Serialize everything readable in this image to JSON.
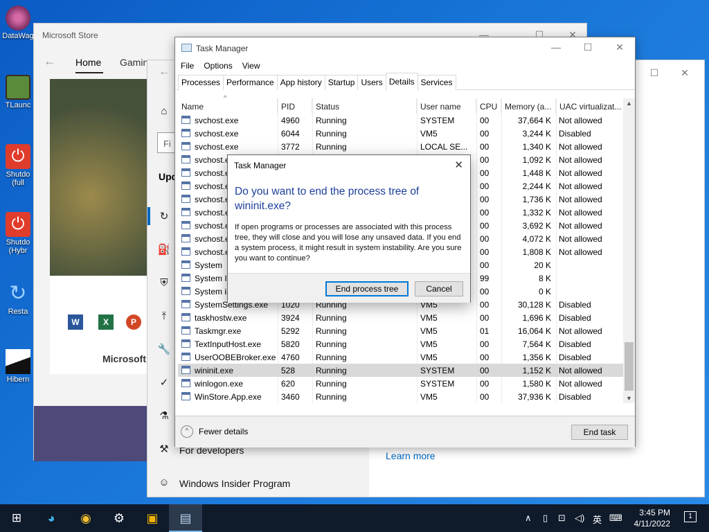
{
  "desktop": {
    "icons": [
      {
        "label": "DataWag",
        "color": "#b14a8a"
      },
      {
        "label": "TLaunc",
        "color": "#4f8a3a"
      },
      {
        "label": "Shutdo",
        "label2": "(full",
        "color": "#e03c2c"
      },
      {
        "label": "Shutdo",
        "label2": "(Hybr",
        "color": "#e03c2c"
      },
      {
        "label": "Resta",
        "color": "#2a8ae6"
      },
      {
        "label": "Hibern",
        "color": "#222222"
      }
    ]
  },
  "store": {
    "title": "Microsoft Store",
    "nav": {
      "home": "Home",
      "gaming": "Gamin"
    },
    "brand": "Microsoft"
  },
  "settings": {
    "header_partial": "Upd",
    "search_partial": "Fi",
    "items": [
      {
        "icon": "⌂"
      },
      {
        "icon": "↻"
      },
      {
        "icon": "⛽"
      },
      {
        "icon": "⛨"
      },
      {
        "icon": "⤒"
      },
      {
        "icon": "🔧"
      },
      {
        "icon": "✓"
      },
      {
        "icon": "⚗"
      }
    ],
    "for_developers": "For developers",
    "insider": "Windows Insider Program",
    "learn_more": "Learn more"
  },
  "task_manager": {
    "title": "Task Manager",
    "menu": [
      "File",
      "Options",
      "View"
    ],
    "tabs": [
      "Processes",
      "Performance",
      "App history",
      "Startup",
      "Users",
      "Details",
      "Services"
    ],
    "active_tab": "Details",
    "columns": [
      "Name",
      "PID",
      "Status",
      "User name",
      "CPU",
      "Memory (a...",
      "UAC virtualizat..."
    ],
    "rows": [
      {
        "name": "svchost.exe",
        "pid": "4960",
        "status": "Running",
        "user": "SYSTEM",
        "cpu": "00",
        "mem": "37,664 K",
        "uac": "Not allowed"
      },
      {
        "name": "svchost.exe",
        "pid": "6044",
        "status": "Running",
        "user": "VM5",
        "cpu": "00",
        "mem": "3,244 K",
        "uac": "Disabled"
      },
      {
        "name": "svchost.exe",
        "pid": "3772",
        "status": "Running",
        "user": "LOCAL SE...",
        "cpu": "00",
        "mem": "1,340 K",
        "uac": "Not allowed"
      },
      {
        "name": "svchost.exe",
        "pid": "",
        "status": "",
        "user": "",
        "cpu": "00",
        "mem": "1,092 K",
        "uac": "Not allowed"
      },
      {
        "name": "svchost.ex",
        "pid": "",
        "status": "",
        "user": "",
        "cpu": "00",
        "mem": "1,448 K",
        "uac": "Not allowed"
      },
      {
        "name": "svchost.ex",
        "pid": "",
        "status": "",
        "user": "",
        "cpu": "00",
        "mem": "2,244 K",
        "uac": "Not allowed"
      },
      {
        "name": "svchost.ex",
        "pid": "",
        "status": "",
        "user": "",
        "cpu": "00",
        "mem": "1,736 K",
        "uac": "Not allowed"
      },
      {
        "name": "svchost.ex",
        "pid": "",
        "status": "",
        "user": "",
        "cpu": "00",
        "mem": "1,332 K",
        "uac": "Not allowed"
      },
      {
        "name": "svchost.ex",
        "pid": "",
        "status": "",
        "user": "",
        "cpu": "00",
        "mem": "3,692 K",
        "uac": "Not allowed"
      },
      {
        "name": "svchost.ex",
        "pid": "",
        "status": "",
        "user": "",
        "cpu": "00",
        "mem": "4,072 K",
        "uac": "Not allowed"
      },
      {
        "name": "svchost.ex",
        "pid": "",
        "status": "",
        "user": "",
        "cpu": "00",
        "mem": "1,808 K",
        "uac": "Not allowed"
      },
      {
        "name": "System",
        "pid": "",
        "status": "",
        "user": "",
        "cpu": "00",
        "mem": "20 K",
        "uac": ""
      },
      {
        "name": "System Idl",
        "pid": "",
        "status": "",
        "user": "",
        "cpu": "99",
        "mem": "8 K",
        "uac": ""
      },
      {
        "name": "System int",
        "pid": "",
        "status": "",
        "user": "",
        "cpu": "00",
        "mem": "0 K",
        "uac": ""
      },
      {
        "name": "SystemSettings.exe",
        "pid": "1020",
        "status": "Running",
        "user": "VM5",
        "cpu": "00",
        "mem": "30,128 K",
        "uac": "Disabled"
      },
      {
        "name": "taskhostw.exe",
        "pid": "3924",
        "status": "Running",
        "user": "VM5",
        "cpu": "00",
        "mem": "1,696 K",
        "uac": "Disabled"
      },
      {
        "name": "Taskmgr.exe",
        "pid": "5292",
        "status": "Running",
        "user": "VM5",
        "cpu": "01",
        "mem": "16,064 K",
        "uac": "Not allowed"
      },
      {
        "name": "TextInputHost.exe",
        "pid": "5820",
        "status": "Running",
        "user": "VM5",
        "cpu": "00",
        "mem": "7,564 K",
        "uac": "Disabled"
      },
      {
        "name": "UserOOBEBroker.exe",
        "pid": "4760",
        "status": "Running",
        "user": "VM5",
        "cpu": "00",
        "mem": "1,356 K",
        "uac": "Disabled"
      },
      {
        "name": "wininit.exe",
        "pid": "528",
        "status": "Running",
        "user": "SYSTEM",
        "cpu": "00",
        "mem": "1,152 K",
        "uac": "Not allowed"
      },
      {
        "name": "winlogon.exe",
        "pid": "620",
        "status": "Running",
        "user": "SYSTEM",
        "cpu": "00",
        "mem": "1,580 K",
        "uac": "Not allowed"
      },
      {
        "name": "WinStore.App.exe",
        "pid": "3460",
        "status": "Running",
        "user": "VM5",
        "cpu": "00",
        "mem": "37,936 K",
        "uac": "Disabled"
      }
    ],
    "selected_process": "wininit.exe",
    "fewer_details": "Fewer details",
    "end_task": "End task"
  },
  "dialog": {
    "title": "Task Manager",
    "heading": "Do you want to end the process tree of wininit.exe?",
    "body": "If open programs or processes are associated with this process tree, they will close and you will lose any unsaved data. If you end a system process, it might result in system instability. Are you sure you want to continue?",
    "confirm": "End process tree",
    "cancel": "Cancel"
  },
  "taskbar": {
    "time": "3:45 PM",
    "date": "4/11/2022",
    "ime": "英",
    "notifications": "1"
  }
}
